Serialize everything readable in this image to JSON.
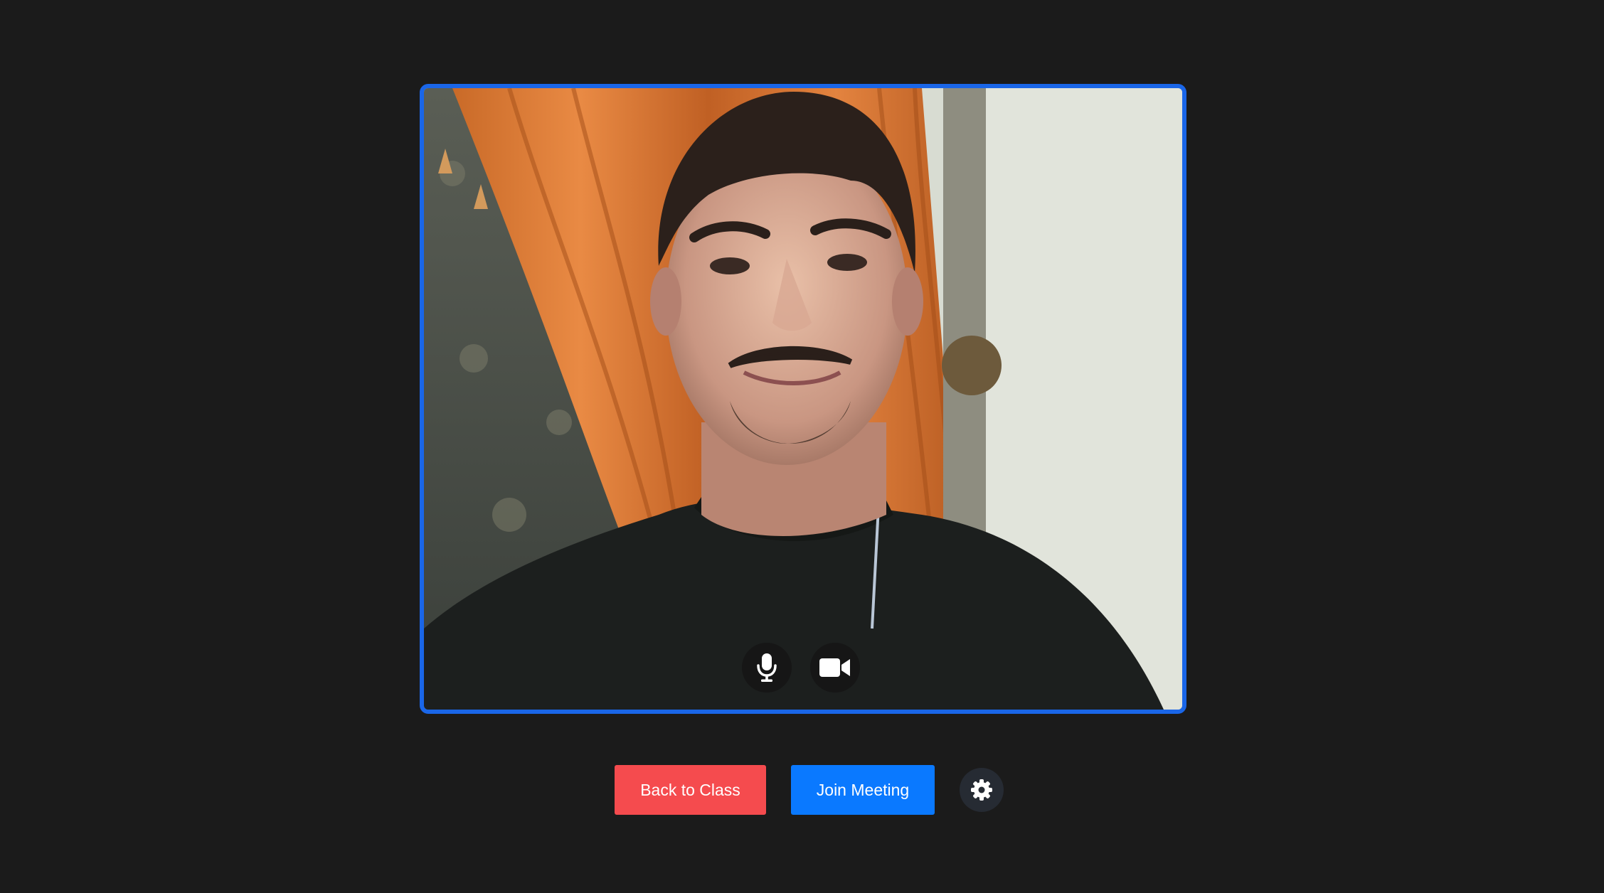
{
  "video": {
    "mic_icon": "microphone-icon",
    "camera_icon": "video-camera-icon",
    "frame_color": "#1a66e8"
  },
  "actions": {
    "back_label": "Back to Class",
    "join_label": "Join Meeting",
    "settings_icon": "gear-icon",
    "back_color": "#f54b4e",
    "join_color": "#0a79ff"
  },
  "theme": {
    "background": "#1b1b1b"
  }
}
